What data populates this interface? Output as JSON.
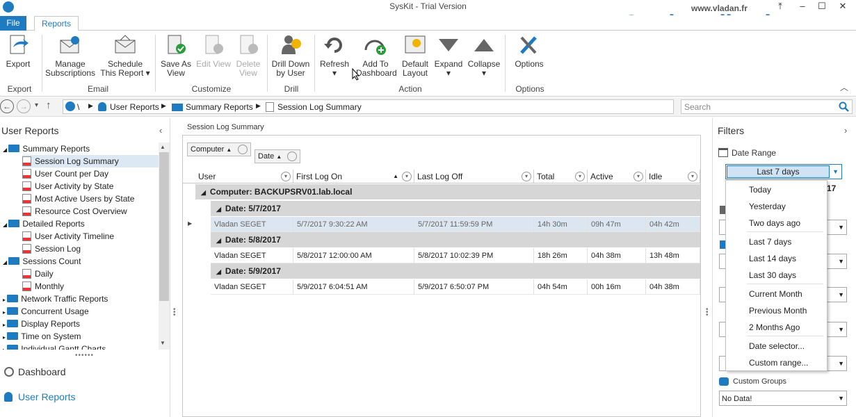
{
  "window": {
    "title": "SysKit - Trial Version"
  },
  "tabs": {
    "file": "File",
    "reports": "Reports"
  },
  "watermark": {
    "brand": "ESXvirtualization",
    "url": "www.vladan.fr"
  },
  "ribbon": {
    "export": "Export",
    "manage": [
      "Manage",
      "Subscriptions"
    ],
    "schedule": [
      "Schedule",
      "This Report"
    ],
    "save_as": [
      "Save As",
      "View"
    ],
    "edit_view": [
      "Edit View"
    ],
    "delete_view": [
      "Delete",
      "View"
    ],
    "drill_down": [
      "Drill Down",
      "by User"
    ],
    "refresh": "Refresh",
    "add_dash": [
      "Add To",
      "Dashboard"
    ],
    "default_layout": [
      "Default",
      "Layout"
    ],
    "expand": "Expand",
    "collapse": "Collapse",
    "options": "Options",
    "groups": {
      "export": "Export",
      "email": "Email",
      "customize": "Customize",
      "drill": "Drill",
      "action": "Action",
      "options": "Options"
    }
  },
  "breadcrumb": {
    "root": "\\",
    "c1": "User Reports",
    "c2": "Summary Reports",
    "c3": "Session Log Summary"
  },
  "search": {
    "placeholder": "Search"
  },
  "left": {
    "header": "User Reports",
    "tree": [
      {
        "label": "Summary Reports",
        "type": "folder",
        "level": 0
      },
      {
        "label": "Session Log Summary",
        "type": "report",
        "level": 1
      },
      {
        "label": "User Count per Day",
        "type": "report",
        "level": 1
      },
      {
        "label": "User Activity by State",
        "type": "report",
        "level": 1
      },
      {
        "label": "Most Active Users by State",
        "type": "report",
        "level": 1
      },
      {
        "label": "Resource Cost Overview",
        "type": "report",
        "level": 1
      },
      {
        "label": "Detailed Reports",
        "type": "folder",
        "level": 0
      },
      {
        "label": "User Activity Timeline",
        "type": "report",
        "level": 1
      },
      {
        "label": "Session Log",
        "type": "report",
        "level": 1
      },
      {
        "label": "Sessions Count",
        "type": "folder",
        "level": 0
      },
      {
        "label": "Daily",
        "type": "report",
        "level": 1
      },
      {
        "label": "Monthly",
        "type": "report",
        "level": 1
      },
      {
        "label": "Network Traffic Reports",
        "type": "folder",
        "level": 0
      },
      {
        "label": "Concurrent Usage",
        "type": "folder",
        "level": 0
      },
      {
        "label": "Display Reports",
        "type": "folder",
        "level": 0
      },
      {
        "label": "Time on System",
        "type": "folder",
        "level": 0
      },
      {
        "label": "Individual Gantt Charts",
        "type": "folder",
        "level": 0
      }
    ],
    "nav_dashboard": "Dashboard",
    "nav_user_reports": "User Reports"
  },
  "report": {
    "title": "Session Log Summary",
    "group_chips": {
      "computer": "Computer",
      "date": "Date"
    },
    "columns": [
      "User",
      "First Log On",
      "Last Log Off",
      "Total",
      "Active",
      "Idle"
    ],
    "computer_group": "Computer: BACKUPSRV01.lab.local",
    "groups": [
      {
        "label": "Date: 5/7/2017",
        "row": [
          "Vladan SEGET",
          "5/7/2017 9:30:22 AM",
          "5/7/2017 11:59:59 PM",
          "14h 30m",
          "09h 47m",
          "04h 42m"
        ]
      },
      {
        "label": "Date: 5/8/2017",
        "row": [
          "Vladan SEGET",
          "5/8/2017 12:00:00 AM",
          "5/8/2017 10:02:39 PM",
          "18h 26m",
          "04h 38m",
          "13h 48m"
        ]
      },
      {
        "label": "Date: 5/9/2017",
        "row": [
          "Vladan SEGET",
          "5/9/2017 6:04:51 AM",
          "5/9/2017 6:50:07 PM",
          "04h 54m",
          "00h 16m",
          "04h 38m"
        ]
      }
    ]
  },
  "filters": {
    "header": "Filters",
    "date_range_label": "Date Range",
    "date_range_value": "Last 7 days",
    "custom_groups_label": "Custom Groups",
    "custom_groups_value": "No Data!",
    "peek_right": "17",
    "dropdown": [
      "Today",
      "Yesterday",
      "Two days ago",
      "Last 7 days",
      "Last 14 days",
      "Last 30 days",
      "Current Month",
      "Previous Month",
      "2 Months Ago",
      "Date selector...",
      "Custom range..."
    ]
  }
}
